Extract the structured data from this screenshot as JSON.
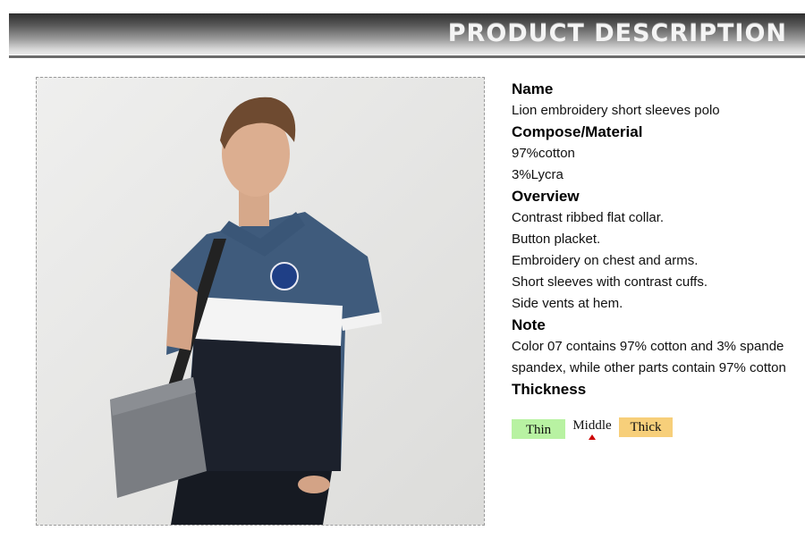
{
  "banner": {
    "title": "PRODUCT DESCRIPTION"
  },
  "product": {
    "name_heading": "Name",
    "name": "Lion embroidery short sleeves polo",
    "material_heading": "Compose/Material",
    "material": [
      "97%cotton",
      "3%Lycra"
    ],
    "overview_heading": "Overview",
    "overview": [
      "Contrast ribbed flat collar.",
      "Button placket.",
      "Embroidery on chest and arms.",
      "Short sleeves with contrast cuffs.",
      "Side vents at hem."
    ],
    "note_heading": "Note",
    "note": [
      "Color 07 contains 97% cotton and 3% spande",
      "spandex, while other parts contain 97% cotton"
    ],
    "thickness_heading": "Thickness",
    "thickness": {
      "options": [
        "Thin",
        "Middle",
        "Thick"
      ],
      "selected": "Middle",
      "colors": {
        "Thin": "#b8f2a2",
        "Thick": "#f7cf7a",
        "marker": "#cc0000"
      }
    }
  },
  "photo": {
    "subject": "model wearing navy, white and black colour-block polo with grey shoulder bag"
  }
}
